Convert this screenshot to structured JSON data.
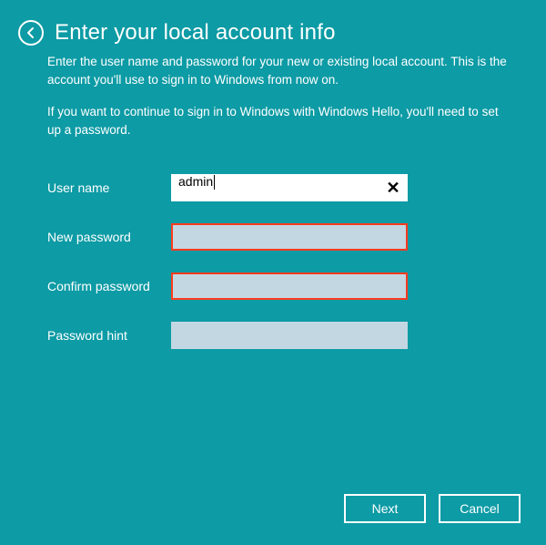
{
  "header": {
    "title": "Enter your local account info"
  },
  "intro": {
    "p1": "Enter the user name and password for your new or existing local account. This is the account you'll use to sign in to Windows from now on.",
    "p2": "If you want to continue to sign in to Windows with Windows Hello, you'll need to set up a password."
  },
  "form": {
    "username_label": "User name",
    "username_value": "admin",
    "newpassword_label": "New password",
    "newpassword_value": "",
    "confirmpassword_label": "Confirm password",
    "confirmpassword_value": "",
    "hint_label": "Password hint",
    "hint_value": ""
  },
  "buttons": {
    "next": "Next",
    "cancel": "Cancel"
  },
  "icons": {
    "clear": "✕"
  }
}
